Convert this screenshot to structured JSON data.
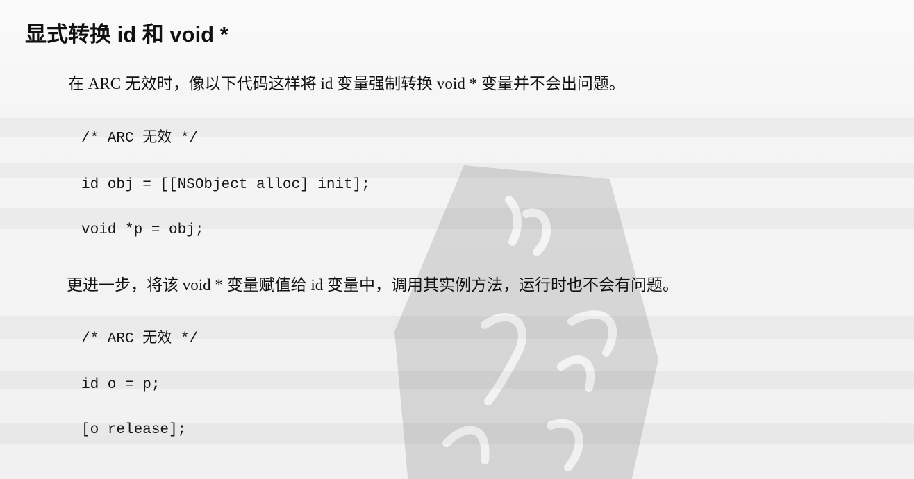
{
  "heading": "显式转换 id 和 void *",
  "paragraphs": [
    "在 ARC 无效时，像以下代码这样将 id 变量强制转换 void * 变量并不会出问题。",
    "更进一步，将该 void * 变量赋值给 id 变量中，调用其实例方法，运行时也不会有问题。"
  ],
  "code_block_1": [
    "/* ARC 无效 */",
    "id obj = [[NSObject alloc] init];",
    "void *p = obj;"
  ],
  "code_block_2": [
    "/* ARC 无效 */",
    "id o = p;",
    "[o release];"
  ]
}
